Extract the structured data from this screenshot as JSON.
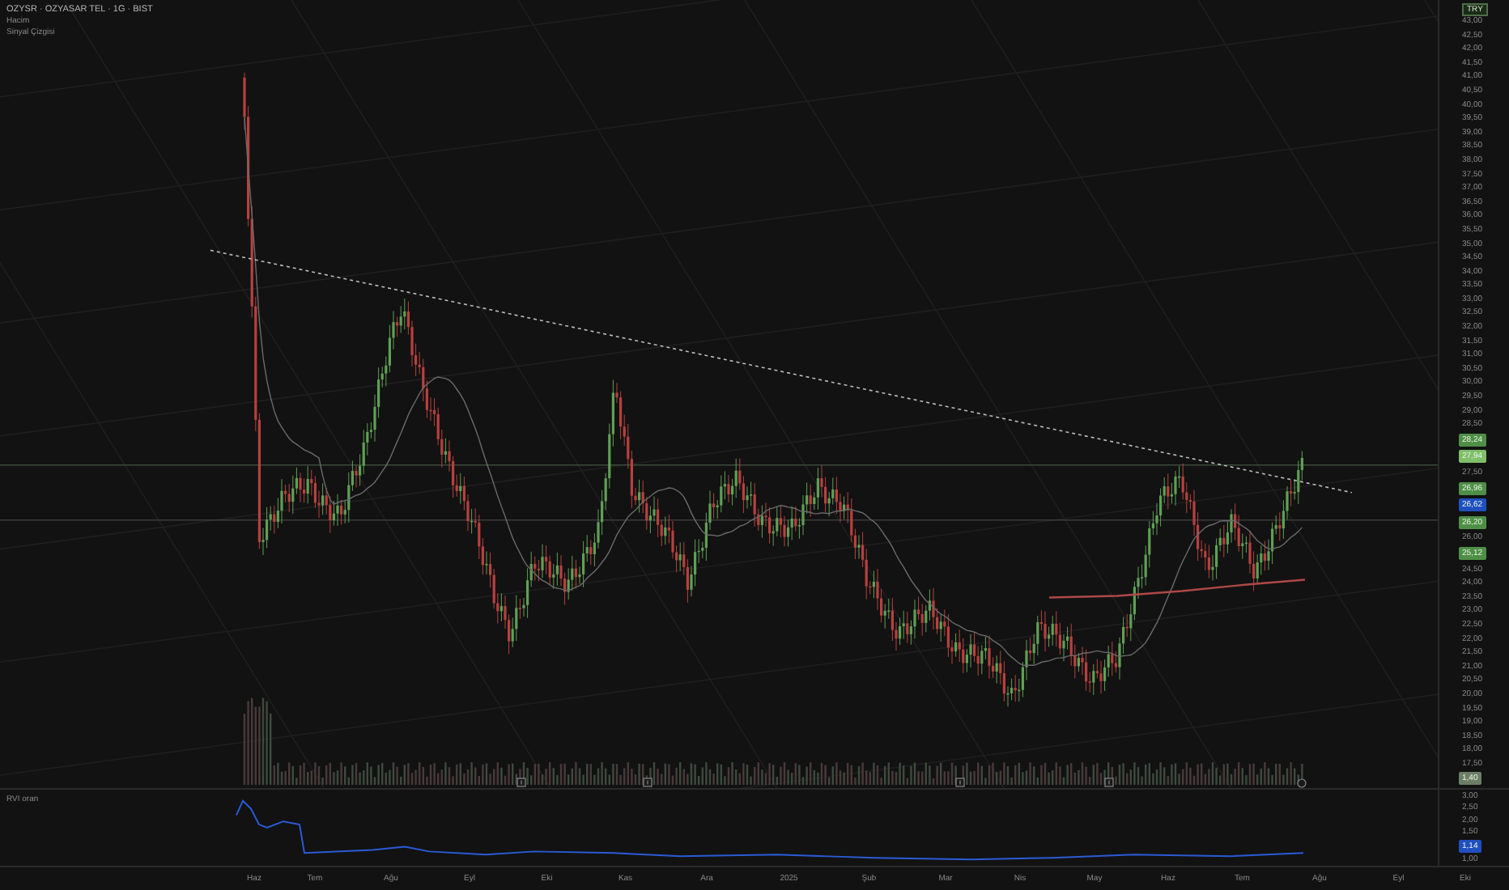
{
  "legend": {
    "title": "OZYSR · OZYASAR TEL · 1G · BIST",
    "lines": [
      "Hacim",
      "Sinyal Çizgisi"
    ]
  },
  "currency": "TRY",
  "price_axis": [
    {
      "kind": "tick",
      "label": "43,00"
    },
    {
      "kind": "tick",
      "label": "42,50"
    },
    {
      "kind": "tick",
      "label": "42,00"
    },
    {
      "kind": "tick",
      "label": "41,50"
    },
    {
      "kind": "tick",
      "label": "41,00"
    },
    {
      "kind": "tick",
      "label": "40,50"
    },
    {
      "kind": "tick",
      "label": "40,00"
    },
    {
      "kind": "tick",
      "label": "39,50"
    },
    {
      "kind": "tick",
      "label": "39,00"
    },
    {
      "kind": "tick",
      "label": "38,50"
    },
    {
      "kind": "tick",
      "label": "38,00"
    },
    {
      "kind": "tick",
      "label": "37,50"
    },
    {
      "kind": "tick",
      "label": "37,00"
    },
    {
      "kind": "tick",
      "label": "36,50"
    },
    {
      "kind": "tick",
      "label": "36,00"
    },
    {
      "kind": "tick",
      "label": "35,50"
    },
    {
      "kind": "tick",
      "label": "35,00"
    },
    {
      "kind": "tick",
      "label": "34,50"
    },
    {
      "kind": "tick",
      "label": "34,00"
    },
    {
      "kind": "tick",
      "label": "33,50"
    },
    {
      "kind": "tick",
      "label": "33,00"
    },
    {
      "kind": "tick",
      "label": "32,50"
    },
    {
      "kind": "tick",
      "label": "32,00"
    },
    {
      "kind": "tick",
      "label": "31,50"
    },
    {
      "kind": "tick",
      "label": "31,00"
    },
    {
      "kind": "tick",
      "label": "30,50"
    },
    {
      "kind": "tick",
      "label": "30,00"
    },
    {
      "kind": "tick",
      "label": "29,50"
    },
    {
      "kind": "tick",
      "label": "29,00"
    },
    {
      "kind": "tick",
      "label": "28,50"
    },
    {
      "kind": "tag",
      "label": "28,24",
      "color": "#4e8f46"
    },
    {
      "kind": "tag",
      "label": "27,94",
      "color": "#7fbf6a"
    },
    {
      "kind": "tick",
      "label": "27,50"
    },
    {
      "kind": "tag",
      "label": "26,96",
      "color": "#4e8f46"
    },
    {
      "kind": "tag",
      "label": "26,62",
      "color": "#1f4fbf"
    },
    {
      "kind": "tag",
      "label": "26,20",
      "color": "#4e8f46"
    },
    {
      "kind": "tick",
      "label": "26,00"
    },
    {
      "kind": "tag",
      "label": "25,12",
      "color": "#4e8f46"
    },
    {
      "kind": "tick",
      "label": "24,50"
    },
    {
      "kind": "tick",
      "label": "24,00"
    },
    {
      "kind": "tick",
      "label": "23,50"
    },
    {
      "kind": "tick",
      "label": "23,00"
    },
    {
      "kind": "tick",
      "label": "22,50"
    },
    {
      "kind": "tick",
      "label": "22,00"
    },
    {
      "kind": "tick",
      "label": "21,50"
    },
    {
      "kind": "tick",
      "label": "21,00"
    },
    {
      "kind": "tick",
      "label": "20,50"
    },
    {
      "kind": "tick",
      "label": "20,00"
    },
    {
      "kind": "tick",
      "label": "19,50"
    },
    {
      "kind": "tick",
      "label": "19,00"
    },
    {
      "kind": "tick",
      "label": "18,50"
    },
    {
      "kind": "tick",
      "label": "18,00"
    },
    {
      "kind": "tick",
      "label": "17,50"
    },
    {
      "kind": "tag",
      "label": "1,40",
      "color": "#6b7f66"
    }
  ],
  "indicator": {
    "title": "RVI oran",
    "axis": [
      {
        "kind": "tick",
        "label": "3,00"
      },
      {
        "kind": "tick",
        "label": "2,50"
      },
      {
        "kind": "tick",
        "label": "2,00"
      },
      {
        "kind": "tick",
        "label": "1,50"
      },
      {
        "kind": "tag",
        "label": "1,14",
        "color": "#1f4fbf"
      },
      {
        "kind": "tick",
        "label": "1,00"
      }
    ]
  },
  "time_axis": {
    "labels": [
      "Haz",
      "Tem",
      "Ağu",
      "Eyl",
      "Eki",
      "Kas",
      "Ara",
      "2025",
      "Şub",
      "Mar",
      "Nis",
      "May",
      "Haz",
      "Tem",
      "Ağu",
      "Eyl",
      "Eki"
    ]
  }
}
